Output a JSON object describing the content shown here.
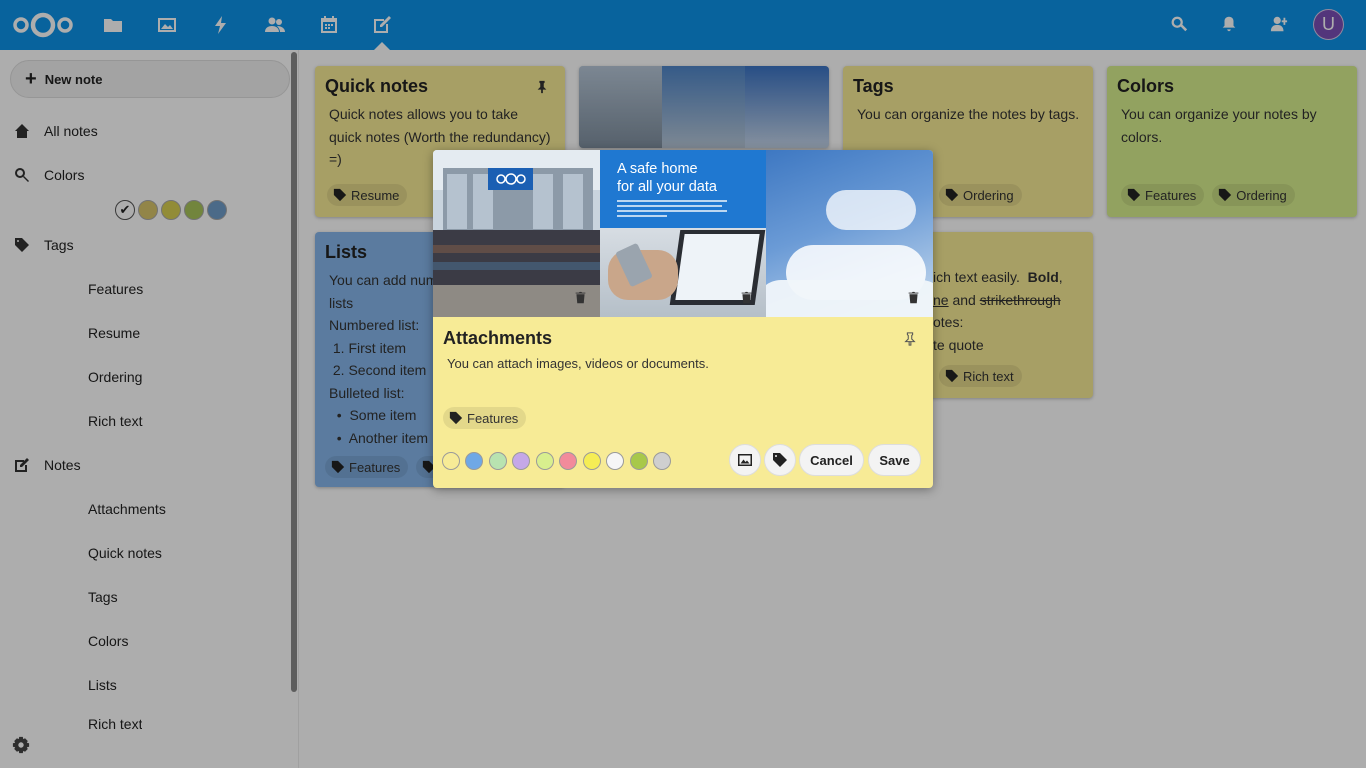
{
  "sidebar": {
    "new_note": "New note",
    "all_notes": "All notes",
    "colors": "Colors",
    "tags": "Tags",
    "tag_items": [
      "Features",
      "Resume",
      "Ordering",
      "Rich text"
    ],
    "notes": "Notes",
    "note_items": [
      "Attachments",
      "Quick notes",
      "Tags",
      "Colors",
      "Lists",
      "Rich text"
    ],
    "color_swatches": [
      "#d8c56a",
      "#d8cf52",
      "#a9c45a",
      "#6f9cc9"
    ]
  },
  "notes": {
    "quick": {
      "title": "Quick notes",
      "line1": "Quick notes allows you to take",
      "line2": "quick notes (Worth the redundancy)",
      "line3": "=)",
      "tag": "Resume"
    },
    "tags": {
      "title": "Tags",
      "body": "You can organize the notes by tags.",
      "tag": "Ordering"
    },
    "colors": {
      "title": "Colors",
      "line1": "You can organize your notes by",
      "line2": "colors.",
      "tags": [
        "Features",
        "Ordering"
      ]
    },
    "lists": {
      "title": "Lists",
      "line1": "You can add num",
      "line2": "lists",
      "numbered_label": "Numbered list:",
      "numbered": [
        "First item",
        "Second item"
      ],
      "bulleted_label": "Bulleted list:",
      "bulleted": [
        "Some item",
        "Another item"
      ],
      "tag": "Features"
    },
    "rich": {
      "line1a": "ich text easily.",
      "bold": "Bold",
      "comma": ",",
      "underline_frag": "ne",
      "and": "and",
      "strike": "strikethrough",
      "line3": "otes:",
      "line4": "te quote",
      "tag": "Rich text"
    }
  },
  "modal": {
    "title": "Attachments",
    "body": "You can attach images, videos or documents.",
    "tag": "Features",
    "image2_heading1": "A safe home",
    "image2_heading2": "for all your data",
    "colors": [
      "#f7eb96",
      "#6fa8e6",
      "#b8e3b0",
      "#c5a8e8",
      "#d8ef8e",
      "#f28b9b",
      "#f5ed55",
      "#f6f6f6",
      "#a8c84a",
      "#cfcfcf"
    ],
    "cancel": "Cancel",
    "save": "Save"
  },
  "user": {
    "avatar_letter": "U"
  }
}
